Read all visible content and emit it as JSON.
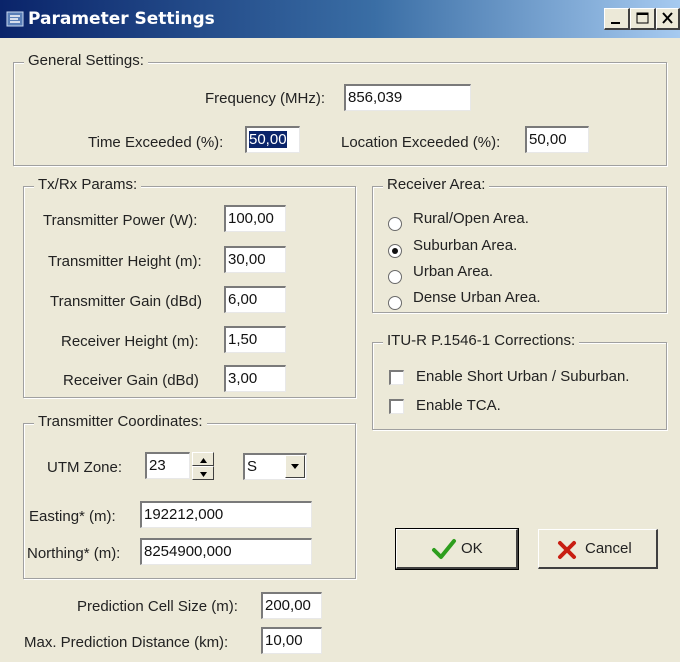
{
  "window": {
    "title": "Parameter Settings",
    "minimize_label": "_",
    "close_label": "X"
  },
  "general": {
    "legend": "General Settings:",
    "frequency_label": "Frequency (MHz):",
    "frequency_value": "856,039",
    "time_label": "Time Exceeded (%):",
    "time_value": "50,00",
    "location_label": "Location Exceeded (%):",
    "location_value": "50,00"
  },
  "txrx": {
    "legend": "Tx/Rx Params:",
    "tx_power_label": "Transmitter Power (W):",
    "tx_power_value": "100,00",
    "tx_height_label": "Transmitter Height (m):",
    "tx_height_value": "30,00",
    "tx_gain_label": "Transmitter Gain (dBd)",
    "tx_gain_value": "6,00",
    "rx_height_label": "Receiver Height (m):",
    "rx_height_value": "1,50",
    "rx_gain_label": "Receiver Gain (dBd)",
    "rx_gain_value": "3,00"
  },
  "receiver_area": {
    "legend": "Receiver Area:",
    "options": [
      "Rural/Open Area.",
      "Suburban Area.",
      "Urban Area.",
      "Dense Urban Area."
    ],
    "selected_index": 1
  },
  "itu": {
    "legend": "ITU-R P.1546-1 Corrections:",
    "short_urban_label": "Enable Short Urban / Suburban.",
    "short_urban_checked": false,
    "tca_label": "Enable TCA.",
    "tca_checked": false
  },
  "coords": {
    "legend": "Transmitter Coordinates:",
    "utm_zone_label": "UTM Zone:",
    "utm_zone_value": "23",
    "hemisphere_value": "S",
    "easting_label": "Easting* (m):",
    "easting_value": "192212,000",
    "northing_label": "Northing* (m):",
    "northing_value": "8254900,000"
  },
  "prediction": {
    "cell_size_label": "Prediction Cell Size (m):",
    "cell_size_value": "200,00",
    "max_distance_label": "Max. Prediction Distance (km):",
    "max_distance_value": "10,00"
  },
  "buttons": {
    "ok_label": "OK",
    "cancel_label": "Cancel"
  },
  "colors": {
    "title_bar": "#0a246a",
    "dialog_bg": "#ece9d8",
    "ok_check": "#2e9e1e",
    "cancel_x": "#c81e12"
  }
}
